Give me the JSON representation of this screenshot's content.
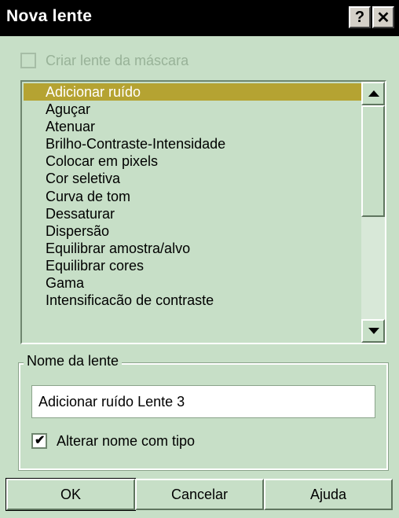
{
  "window": {
    "title": "Nova lente",
    "help_glyph": "?",
    "close_glyph": "✕"
  },
  "mask_checkbox": {
    "label": "Criar lente da máscara",
    "checked": false,
    "enabled": false
  },
  "lens_list": {
    "selected_index": 0,
    "items": [
      "Adicionar ruído",
      "Aguçar",
      "Atenuar",
      "Brilho-Contraste-Intensidade",
      "Colocar em pixels",
      "Cor seletiva",
      "Curva de tom",
      "Dessaturar",
      "Dispersão",
      "Equilibrar amostra/alvo",
      "Equilibrar cores",
      "Gama",
      "Intensificacão de contraste"
    ]
  },
  "lens_name_group": {
    "label": "Nome da lente",
    "name_value": "Adicionar ruído Lente 3",
    "change_name_checkbox": {
      "label": "Alterar nome com tipo",
      "checked": true,
      "check_glyph": "✔"
    }
  },
  "buttons": {
    "ok": "OK",
    "cancel": "Cancelar",
    "help": "Ajuda"
  },
  "colors": {
    "dialog_bg": "#c7dfc7",
    "titlebar_bg": "#000000",
    "selection_bg": "#b5a332"
  }
}
